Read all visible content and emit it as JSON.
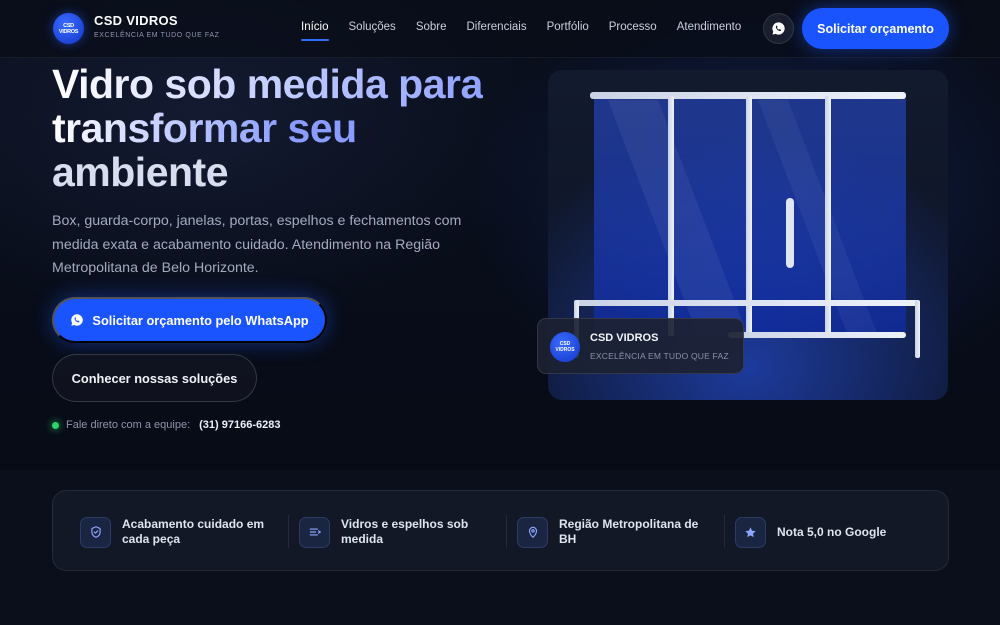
{
  "brand": {
    "logo_text": "CSD VIDROS",
    "name": "CSD VIDROS",
    "tagline": "EXCELÊNCIA EM TUDO QUE FAZ"
  },
  "nav": {
    "links": [
      "Início",
      "Soluções",
      "Sobre",
      "Diferenciais",
      "Portfólio",
      "Processo",
      "Atendimento"
    ],
    "active_index": 0,
    "cta_label": "Solicitar orçamento"
  },
  "hero": {
    "title_line1": "Vidro sob medida para",
    "title_line2a": "transformar",
    "title_line2b": "seu",
    "title_line3": "ambiente",
    "description": "Box, guarda-corpo, janelas, portas, espelhos e fechamentos com medida exata e acabamento cuidado. Atendimento na Região Metropolitana de Belo Horizonte.",
    "primary_button": "Solicitar orçamento pelo WhatsApp",
    "secondary_button": "Conhecer nossas soluções",
    "contact_label": "Fale direto com a equipe:",
    "contact_phone": "(31) 97166-6283"
  },
  "brand_chip": {
    "logo_text": "CSD VIDROS",
    "name": "CSD VIDROS",
    "tagline": "EXCELÊNCIA EM TUDO QUE FAZ"
  },
  "features": [
    {
      "icon": "shield-check-icon",
      "text": "Acabamento cuidado em cada peça"
    },
    {
      "icon": "ruler-icon",
      "text": "Vidros e espelhos sob medida"
    },
    {
      "icon": "map-pin-icon",
      "text": "Região Metropolitana de BH"
    },
    {
      "icon": "star-icon",
      "text": "Nota 5,0 no Google"
    }
  ],
  "colors": {
    "accent": "#1a54ff",
    "background": "#070b16",
    "online": "#2fd36b",
    "title_accent": "#8a9cff"
  }
}
